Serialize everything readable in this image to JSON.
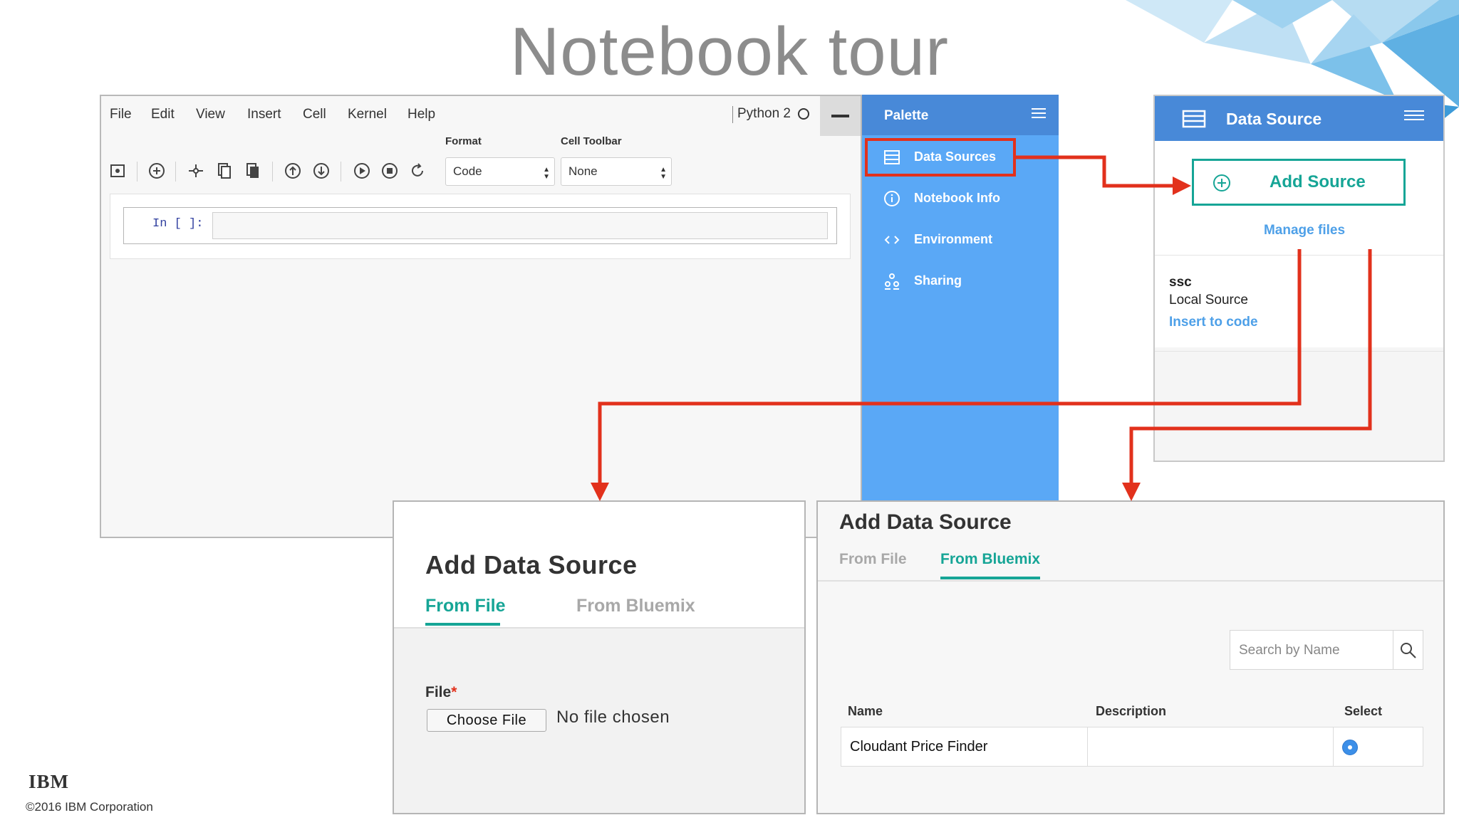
{
  "slide": {
    "title": "Notebook tour",
    "logo": "IBM",
    "copyright": "©2016 IBM Corporation"
  },
  "notebook": {
    "menu": [
      "File",
      "Edit",
      "View",
      "Insert",
      "Cell",
      "Kernel",
      "Help"
    ],
    "kernel": "Python 2",
    "toolbar": {
      "icons": [
        "save-icon",
        "insert-cell-icon",
        "cut-icon",
        "copy-icon",
        "paste-icon",
        "move-up-icon",
        "move-down-icon",
        "run-icon",
        "stop-icon",
        "restart-icon"
      ],
      "format_label": "Format",
      "format_value": "Code",
      "cell_toolbar_label": "Cell Toolbar",
      "cell_toolbar_value": "None"
    },
    "cell_prompt": "In [ ]:"
  },
  "palette": {
    "title": "Palette",
    "items": [
      {
        "label": "Data Sources",
        "icon": "data-sources-icon"
      },
      {
        "label": "Notebook Info",
        "icon": "info-icon"
      },
      {
        "label": "Environment",
        "icon": "code-icon"
      },
      {
        "label": "Sharing",
        "icon": "sharing-icon"
      }
    ]
  },
  "data_source_panel": {
    "title": "Data Source",
    "add_button": "Add Source",
    "manage_link": "Manage files",
    "source": {
      "name": "ssc",
      "type": "Local Source",
      "action": "Insert to code"
    }
  },
  "dialog_file": {
    "title": "Add Data Source",
    "tabs": [
      "From File",
      "From Bluemix"
    ],
    "active_tab": "From File",
    "file_label": "File",
    "required_mark": "*",
    "choose_button": "Choose File",
    "status": "No file chosen"
  },
  "dialog_bluemix": {
    "title": "Add Data Source",
    "tabs": [
      "From File",
      "From Bluemix"
    ],
    "active_tab": "From Bluemix",
    "search_placeholder": "Search by Name",
    "columns": [
      "Name",
      "Description",
      "Select"
    ],
    "rows": [
      {
        "name": "Cloudant Price Finder",
        "description": "",
        "selected": true
      }
    ]
  },
  "colors": {
    "palette_bg": "#5aa8f6",
    "header_blue": "#4889d8",
    "accent_teal": "#16a596",
    "callout_red": "#e2311c",
    "link_blue": "#4ea0e8"
  }
}
